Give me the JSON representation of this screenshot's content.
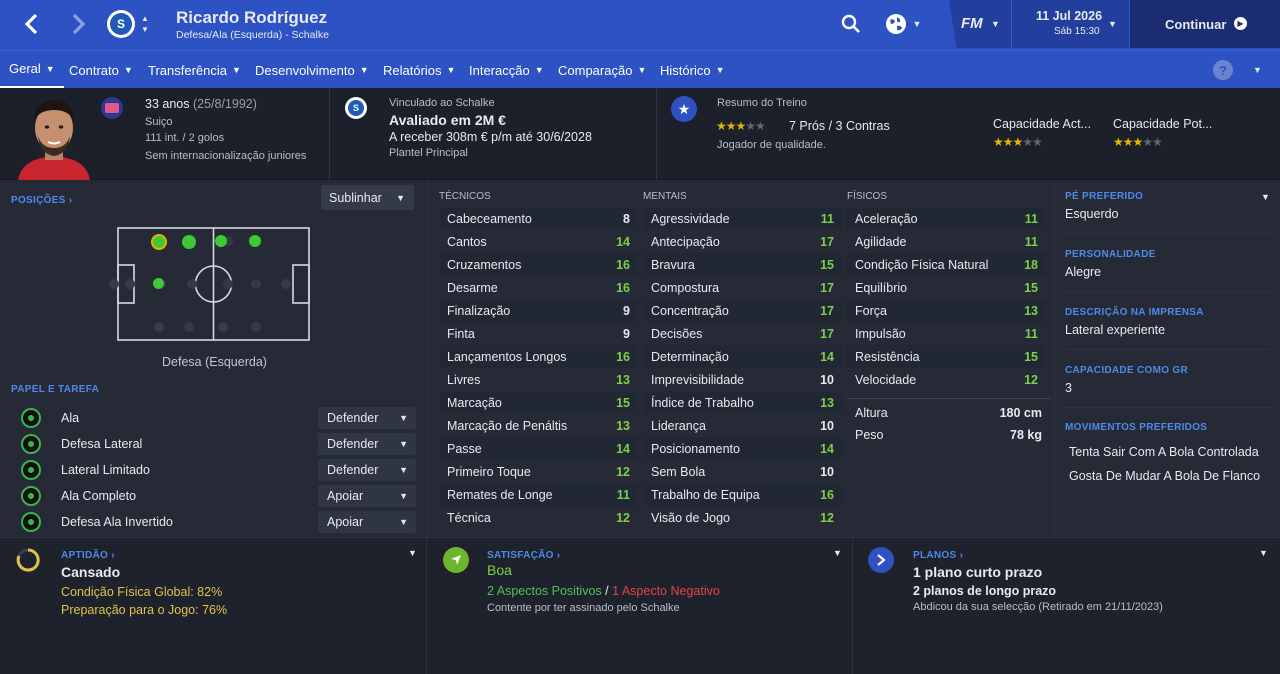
{
  "header": {
    "player_name": "Ricardo Rodríguez",
    "player_subtitle": "Defesa/Ala (Esquerda) - Schalke",
    "date": "11 Jul 2026",
    "day_time": "Sáb 15:30",
    "continue_label": "Continuar",
    "fm_logo": "FM"
  },
  "tabs": [
    {
      "label": "Geral"
    },
    {
      "label": "Contrato"
    },
    {
      "label": "Transferência"
    },
    {
      "label": "Desenvolvimento"
    },
    {
      "label": "Relatórios"
    },
    {
      "label": "Interacção"
    },
    {
      "label": "Comparação"
    },
    {
      "label": "Histórico"
    }
  ],
  "info": {
    "age": "33 anos",
    "dob": "(25/8/1992)",
    "nationality": "Suiço",
    "caps": "111 int. / 2 golos",
    "youth": "Sem internacionalização juniores",
    "linked": "Vinculado ao Schalke",
    "value": "Avaliado em 2M €",
    "wage": "A receber 308m € p/m até 30/6/2028",
    "squad": "Plantel Principal",
    "training_title": "Resumo do Treino",
    "pros_cons": "7 Prós / 3 Contras",
    "training_desc": "Jogador de qualidade.",
    "ca_label": "Capacidade Act...",
    "pa_label": "Capacidade Pot...",
    "training_stars": 3,
    "ca_stars": 3,
    "pa_stars": 3
  },
  "left": {
    "positions_label": "POSIÇÕES",
    "highlight_select": "Sublinhar",
    "position_caption": "Defesa (Esquerda)",
    "roles_label": "PAPEL E TAREFA",
    "roles": [
      {
        "role": "Ala",
        "duty": "Defender"
      },
      {
        "role": "Defesa Lateral",
        "duty": "Defender"
      },
      {
        "role": "Lateral Limitado",
        "duty": "Defender"
      },
      {
        "role": "Ala Completo",
        "duty": "Apoiar"
      },
      {
        "role": "Defesa Ala Invertido",
        "duty": "Apoiar"
      }
    ]
  },
  "attributes": {
    "technical_label": "TÉCNICOS",
    "mental_label": "MENTAIS",
    "physical_label": "FÍSICOS",
    "technical": [
      {
        "name": "Cabeceamento",
        "value": "8"
      },
      {
        "name": "Cantos",
        "value": "14"
      },
      {
        "name": "Cruzamentos",
        "value": "16"
      },
      {
        "name": "Desarme",
        "value": "16"
      },
      {
        "name": "Finalização",
        "value": "9"
      },
      {
        "name": "Finta",
        "value": "9"
      },
      {
        "name": "Lançamentos Longos",
        "value": "16"
      },
      {
        "name": "Livres",
        "value": "13"
      },
      {
        "name": "Marcação",
        "value": "15"
      },
      {
        "name": "Marcação de Penáltis",
        "value": "13"
      },
      {
        "name": "Passe",
        "value": "14"
      },
      {
        "name": "Primeiro Toque",
        "value": "12"
      },
      {
        "name": "Remates de Longe",
        "value": "11"
      },
      {
        "name": "Técnica",
        "value": "12"
      }
    ],
    "mental": [
      {
        "name": "Agressividade",
        "value": "11"
      },
      {
        "name": "Antecipação",
        "value": "17"
      },
      {
        "name": "Bravura",
        "value": "15"
      },
      {
        "name": "Compostura",
        "value": "17"
      },
      {
        "name": "Concentração",
        "value": "17"
      },
      {
        "name": "Decisões",
        "value": "17"
      },
      {
        "name": "Determinação",
        "value": "14"
      },
      {
        "name": "Imprevisibilidade",
        "value": "10"
      },
      {
        "name": "Índice de Trabalho",
        "value": "13"
      },
      {
        "name": "Liderança",
        "value": "10"
      },
      {
        "name": "Posicionamento",
        "value": "14"
      },
      {
        "name": "Sem Bola",
        "value": "10"
      },
      {
        "name": "Trabalho de Equipa",
        "value": "16"
      },
      {
        "name": "Visão de Jogo",
        "value": "12"
      }
    ],
    "physical": [
      {
        "name": "Aceleração",
        "value": "11"
      },
      {
        "name": "Agilidade",
        "value": "11"
      },
      {
        "name": "Condição Física Natural",
        "value": "18"
      },
      {
        "name": "Equilíbrio",
        "value": "15"
      },
      {
        "name": "Força",
        "value": "13"
      },
      {
        "name": "Impulsão",
        "value": "11"
      },
      {
        "name": "Resistência",
        "value": "15"
      },
      {
        "name": "Velocidade",
        "value": "12"
      }
    ],
    "height_label": "Altura",
    "height": "180 cm",
    "weight_label": "Peso",
    "weight": "78 kg"
  },
  "right": {
    "foot_label": "PÉ PREFERIDO",
    "foot": "Esquerdo",
    "personality_label": "PERSONALIDADE",
    "personality": "Alegre",
    "media_label": "DESCRIÇÃO NA IMPRENSA",
    "media": "Lateral experiente",
    "gk_label": "CAPACIDADE COMO GR",
    "gk": "3",
    "ppm_label": "MOVIMENTOS PREFERIDOS",
    "ppms": [
      "Tenta Sair Com A Bola Controlada",
      "Gosta De Mudar A Bola De Flanco"
    ]
  },
  "bottom": {
    "fitness_label": "APTIDÃO",
    "fitness_state": "Cansado",
    "fitness_line1": "Condição Física Global: 82%",
    "fitness_line2": "Preparação para o Jogo: 76%",
    "happiness_label": "SATISFAÇÃO",
    "happiness_state": "Boa",
    "positives": "2 Aspectos Positivos",
    "slash": "/",
    "negatives": "1 Aspecto Negativo",
    "happiness_note": "Contente por ter assinado pelo Schalke",
    "plans_label": "PLANOS",
    "plans_line1": "1 plano curto prazo",
    "plans_line2": "2 planos de longo prazo",
    "plans_note": "Abdicou da sua selecção (Retirado em 21/11/2023)"
  },
  "colors": {
    "topbar": "#2c52c3",
    "accent": "#4f8ae8",
    "good": "#7ccf4a",
    "warn": "#e2c24a",
    "bad": "#e0454a"
  }
}
